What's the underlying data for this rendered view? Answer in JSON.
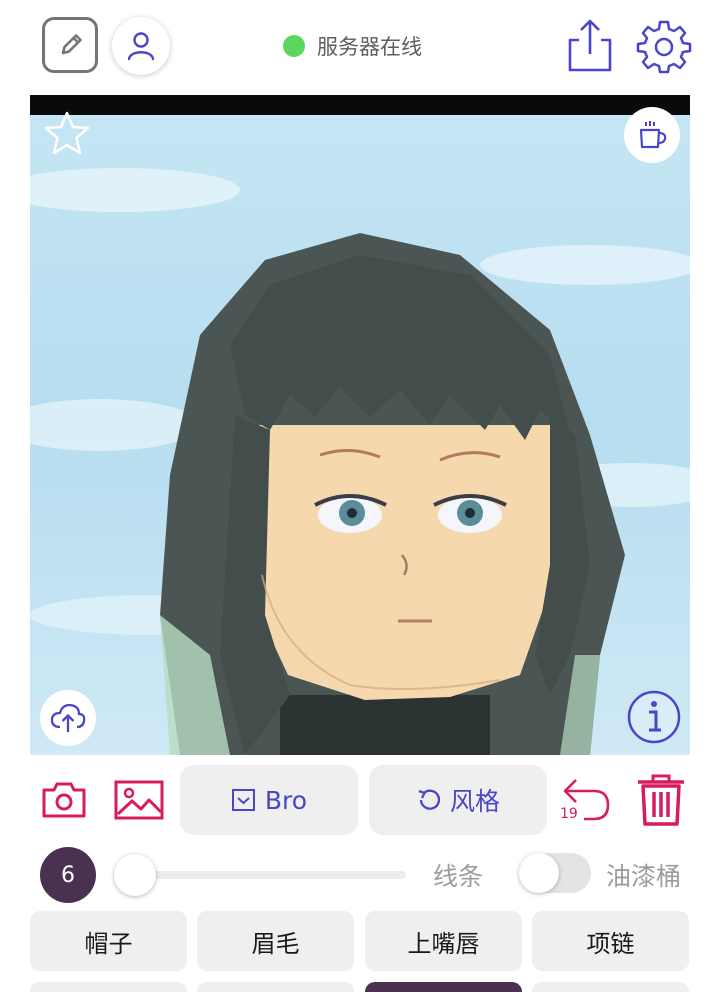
{
  "header": {
    "server_status_text": "服务器在线",
    "server_status_color": "#5bd65e",
    "icons": [
      "edit-icon",
      "user-icon",
      "share-icon",
      "settings-icon"
    ]
  },
  "canvas": {
    "icons": [
      "star-icon",
      "coffee-cup-icon",
      "upload-cloud-icon",
      "info-icon"
    ],
    "content": "anime-style portrait with dark hair on sky background"
  },
  "toolbar": {
    "model_label": "Bro",
    "style_label": "风格",
    "undo_count": "19",
    "accent_color": "#d81b60",
    "button_text_color": "#4a45c9"
  },
  "brush": {
    "size_value": "6",
    "slider_level": 0.0,
    "lines_label": "线条",
    "bucket_label": "油漆桶",
    "bucket_enabled": false
  },
  "categories": {
    "row1": [
      "帽子",
      "眉毛",
      "上嘴唇",
      "项链"
    ],
    "row2_active_index": 2
  }
}
